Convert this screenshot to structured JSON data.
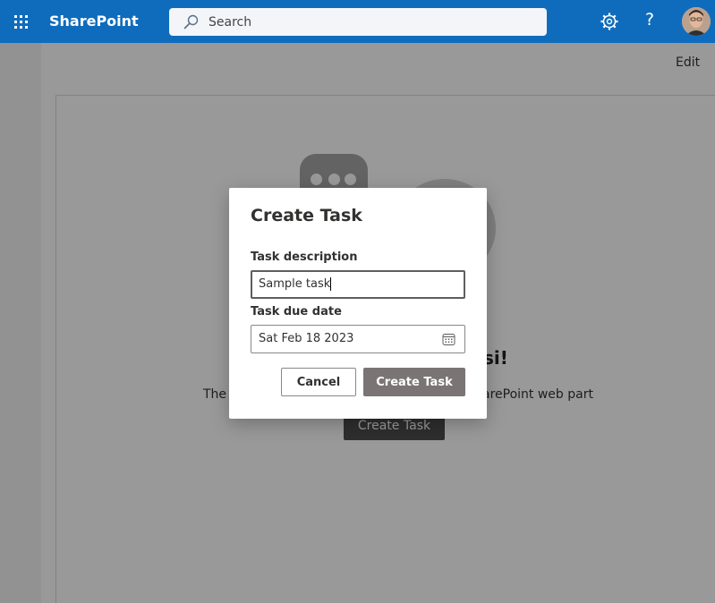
{
  "suitebar": {
    "app_name": "SharePoint",
    "search_placeholder": "Search",
    "accent_color": "#0f6cbd",
    "icons": [
      "app-launcher-icon",
      "search-icon",
      "gear-icon",
      "help-icon",
      "avatar"
    ]
  },
  "page": {
    "edit_label": "Edit",
    "greeting_fragment": "si!",
    "description_left": "The a",
    "description_right": "arePoint web part",
    "background_button_label": "Create Task"
  },
  "dialog": {
    "title": "Create Task",
    "task_description": {
      "label": "Task description",
      "value": "Sample task"
    },
    "task_due_date": {
      "label": "Task due date",
      "value": "Sat Feb 18 2023",
      "icon": "calendar-icon"
    },
    "cancel_label": "Cancel",
    "create_label": "Create Task"
  }
}
